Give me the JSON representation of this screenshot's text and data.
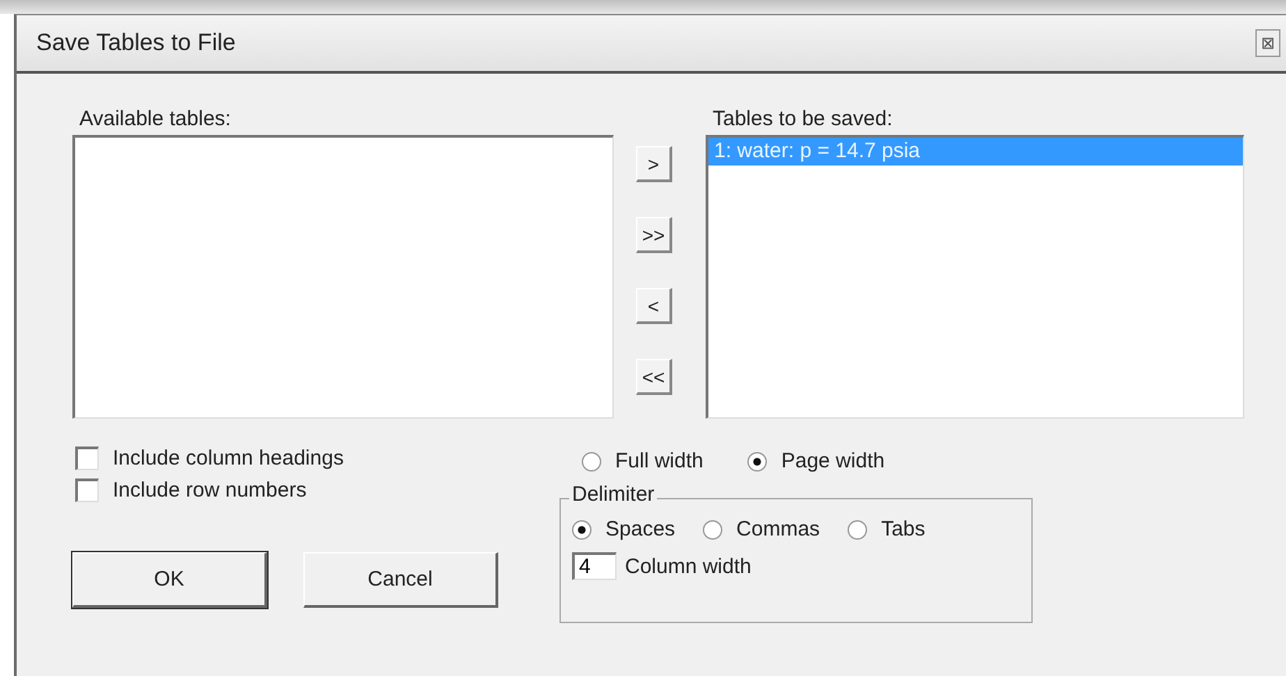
{
  "window": {
    "title": "Save Tables to File",
    "close": "⊠"
  },
  "available": {
    "label": "Available tables:"
  },
  "move_buttons": [
    {
      "label": ">"
    },
    {
      "label": ">>"
    },
    {
      "label": "<"
    },
    {
      "label": "<<"
    }
  ],
  "saved": {
    "label": "Tables to be saved:",
    "items": [
      {
        "label": "1: water: p = 14.7 psia",
        "selected": true
      }
    ]
  },
  "checkboxes": [
    {
      "label": "Include column headings",
      "checked": false
    },
    {
      "label": "Include row numbers",
      "checked": false
    }
  ],
  "width_options": [
    {
      "label": "Full width",
      "selected": false
    },
    {
      "label": "Page width",
      "selected": true
    }
  ],
  "delimiter": {
    "title": "Delimiter",
    "options": [
      {
        "label": "Spaces",
        "selected": true
      },
      {
        "label": "Commas",
        "selected": false
      },
      {
        "label": "Tabs",
        "selected": false
      }
    ],
    "column_width": {
      "value": "4",
      "label": "Column width"
    }
  },
  "buttons": [
    {
      "label": "OK",
      "default": true
    },
    {
      "label": "Cancel",
      "default": false
    }
  ]
}
